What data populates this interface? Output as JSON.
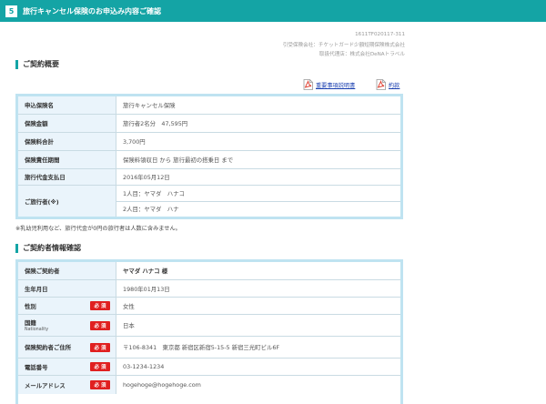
{
  "header": {
    "step": "5",
    "title": "旅行キャンセル保険のお申込み内容ご確認"
  },
  "meta": {
    "code": "1611TF020117-311",
    "insurer": "引受保険会社：チケットガード少額短期保険株式会社",
    "agent": "取扱代理店：株式会社DeNAトラベル"
  },
  "contract_summary": {
    "title": "ご契約概要",
    "links": {
      "important_notes": "重要事項説明書",
      "terms": "約款"
    },
    "rows": [
      {
        "label": "申込保険名",
        "value": "旅行キャンセル保険"
      },
      {
        "label": "保険金額",
        "value": "旅行者2名分　47,595円"
      },
      {
        "label": "保険料合計",
        "value": "3,700円"
      },
      {
        "label": "保険責任期間",
        "value": "保険料領収日 から 旅行最初の搭乗日 まで"
      },
      {
        "label": "旅行代金支払日",
        "value": "2016年05月12日"
      }
    ],
    "travelers": {
      "label": "ご旅行者(※)",
      "values": [
        "1人目：ヤマダ　ハナコ",
        "2人目：ヤマダ　ハナ"
      ]
    }
  },
  "note": "※乳幼児利用など、旅行代金が0円の旅行者は人数に含みません。",
  "policyholder": {
    "title": "ご契約者情報確認",
    "required_label": "必 須",
    "rows": [
      {
        "label": "保険ご契約者",
        "value": "ヤマダ ハナコ 様"
      },
      {
        "label": "生年月日",
        "value": "1980年01月13日"
      },
      {
        "label": "性別",
        "value": "女性"
      },
      {
        "label": "国籍",
        "sublabel": "Nationality",
        "value": "日本"
      },
      {
        "label": "保険契約者ご住所",
        "value": "〒106-8341　東京都 新宿区新宿5-15-5 新宿三光町ビル6F"
      },
      {
        "label": "電話番号",
        "value": "03-1234-1234"
      },
      {
        "label": "メールアドレス",
        "value": "hogehoge@hogehoge.com"
      }
    ]
  },
  "colors": {
    "accent": "#14a4a5",
    "required": "#e02020",
    "label_bg": "#eaf4fb",
    "table_border": "#bfe3f1",
    "link": "#1a3fb0"
  }
}
